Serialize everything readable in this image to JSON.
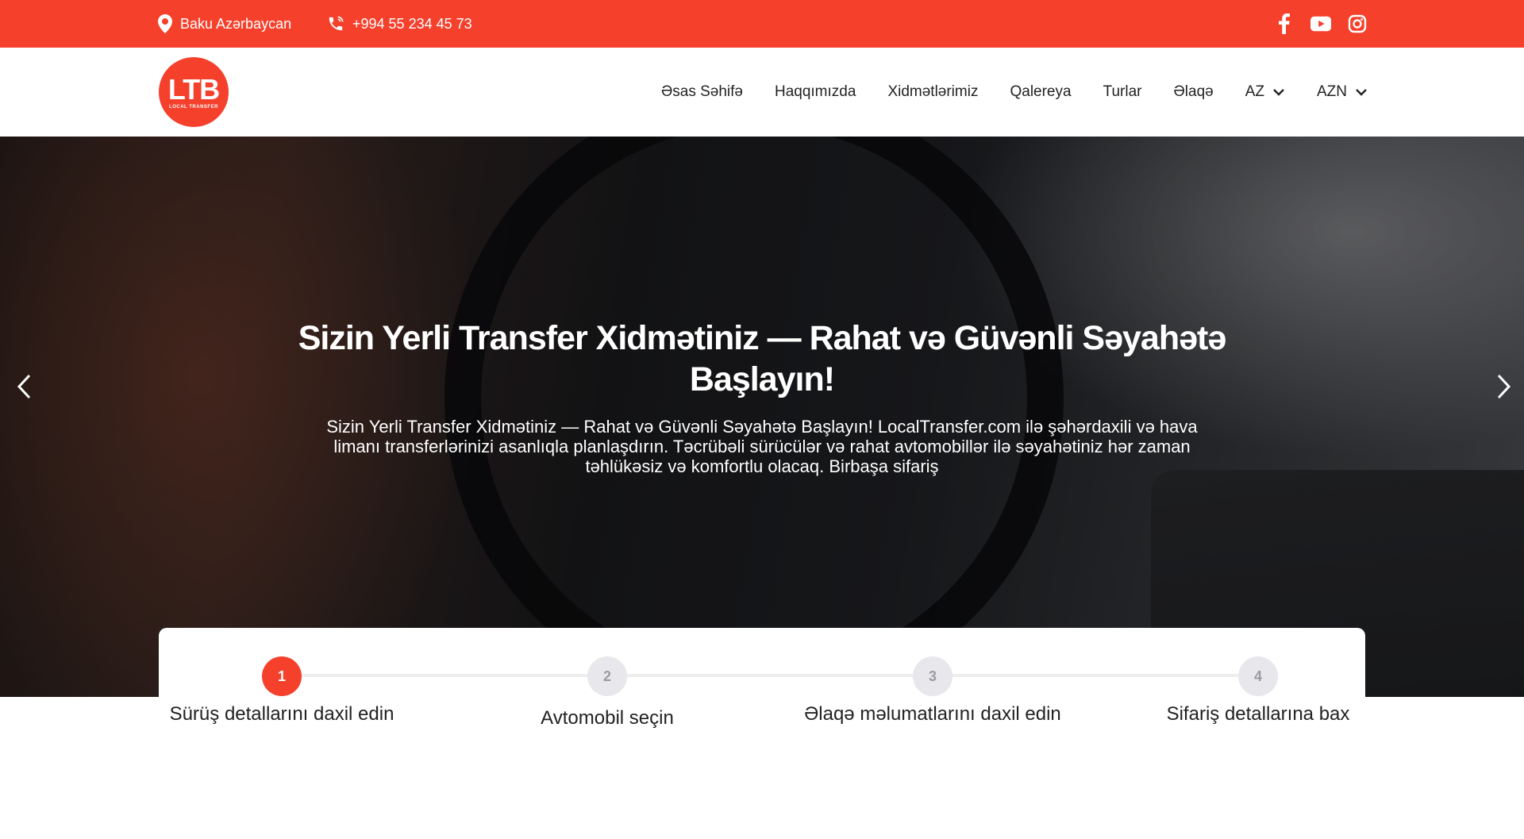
{
  "topbar": {
    "location": "Baku Azərbaycan",
    "phone": "+994 55 234 45 73",
    "socials": [
      "facebook-icon",
      "youtube-icon",
      "instagram-icon"
    ]
  },
  "logo": {
    "main": "LTB",
    "sub": "LOCAL TRANSFER"
  },
  "nav": {
    "items": [
      "Əsas Səhifə",
      "Haqqımızda",
      "Xidmətlərimiz",
      "Qalereya",
      "Turlar",
      "Əlaqə"
    ],
    "language": "AZ",
    "currency": "AZN"
  },
  "hero": {
    "title": "Sizin Yerli Transfer Xidmətiniz — Rahat və Güvənli Səyahətə Başlayın!",
    "text": "Sizin Yerli Transfer Xidmətiniz — Rahat və Güvənli Səyahətə Başlayın! LocalTransfer.com ilə şəhərdaxili və hava limanı transferlərinizi asanlıqla planlaşdırın. Təcrübəli sürücülər və rahat avtomobillər ilə səyahətiniz hər zaman təhlükəsiz və komfortlu olacaq. Birbaşa sifariş"
  },
  "steps": [
    {
      "number": "1",
      "label": "Sürüş detallarını daxil edin",
      "active": true
    },
    {
      "number": "2",
      "label": "Avtomobil seçin",
      "active": false
    },
    {
      "number": "3",
      "label": "Əlaqə məlumatlarını daxil edin",
      "active": false
    },
    {
      "number": "4",
      "label": "Sifariş detallarına bax",
      "active": false
    }
  ],
  "colors": {
    "accent": "#f5402c",
    "step_inactive_bg": "#e8e8ec",
    "step_inactive_text": "#9b9ba2"
  }
}
